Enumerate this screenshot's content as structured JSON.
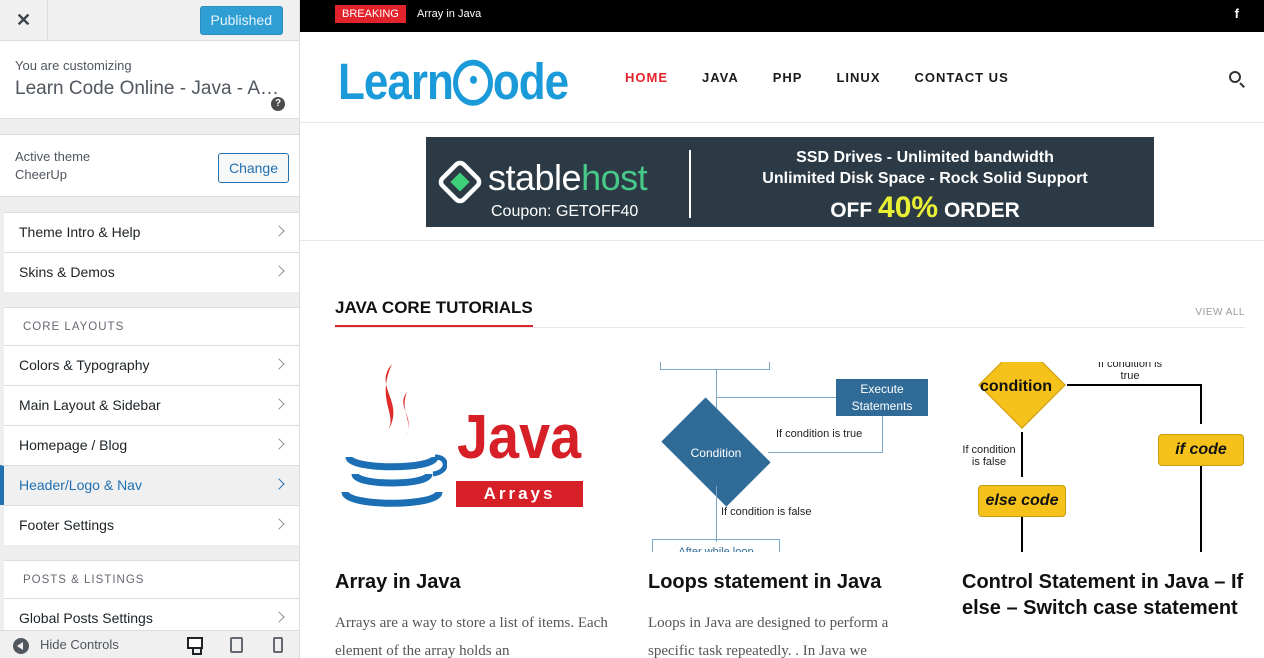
{
  "customizer": {
    "close_symbol": "✕",
    "publish_label": "Published",
    "customizing_label": "You are customizing",
    "site_title": "Learn Code Online - Java - Android - PHP - Linux",
    "help_symbol": "?",
    "active_theme_label": "Active theme",
    "theme_name": "CheerUp",
    "change_label": "Change",
    "items_top": [
      "Theme Intro & Help",
      "Skins & Demos"
    ],
    "core_layouts_heading": "CORE LAYOUTS",
    "items_core": [
      "Colors & Typography",
      "Main Layout & Sidebar",
      "Homepage / Blog",
      "Header/Logo & Nav",
      "Footer Settings"
    ],
    "active_item": "Header/Logo & Nav",
    "posts_heading": "POSTS & LISTINGS",
    "items_posts": [
      "Global Posts Settings"
    ],
    "hide_controls_label": "Hide Controls",
    "devices": [
      "desktop-icon",
      "tablet-icon",
      "mobile-icon"
    ]
  },
  "site": {
    "breaking_label": "BREAKING",
    "breaking_text": "Array in Java",
    "facebook_symbol": "f",
    "logo_left": "Learn",
    "logo_right": "ode",
    "logo_color": "#1a9ad8",
    "nav": [
      "HOME",
      "JAVA",
      "PHP",
      "LINUX",
      "CONTACT US"
    ],
    "nav_current": "HOME",
    "accent_color": "#e3232c"
  },
  "ad": {
    "brand_left": "stable",
    "brand_right": "host",
    "coupon": "Coupon: GETOFF40",
    "line1": "SSD Drives - Unlimited bandwidth",
    "line2": "Unlimited Disk Space - Rock Solid Support",
    "line3_left": "OFF",
    "line3_pct": "40%",
    "line3_right": "ORDER"
  },
  "section": {
    "title": "JAVA CORE TUTORIALS",
    "view_all": "VIEW ALL"
  },
  "cards": [
    {
      "title": "Array in Java",
      "excerpt": "Arrays are a way to store a list of items. Each element of the array holds an",
      "image": {
        "word": "Java",
        "bar": "Arrays"
      }
    },
    {
      "title": "Loops statement in Java",
      "excerpt": "Loops in Java are designed to perform a specific task repeatedly. . In Java we",
      "image": {
        "box": "Execute Statements",
        "diamond": "Condition",
        "true_label": "If condition is true",
        "false_label": "If condition is false",
        "bottom_label": "After while loop"
      }
    },
    {
      "title": "Control Statement in Java – If else – Switch case statement",
      "excerpt": "",
      "image": {
        "diamond": "condition",
        "true_label": "If condition is true",
        "false_label": "If condition is false",
        "if_code": "if code",
        "else_code": "else code"
      }
    }
  ]
}
